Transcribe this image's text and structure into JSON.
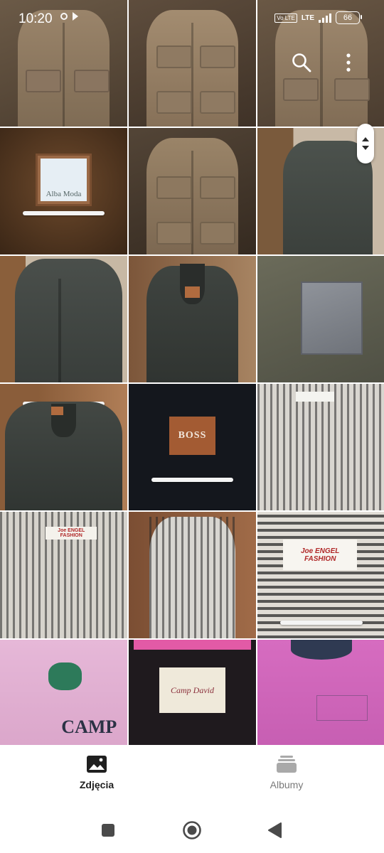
{
  "status_bar": {
    "time": "10:20",
    "network": "LTE",
    "volte": "Vo LTE",
    "battery": "66"
  },
  "toolbar": {
    "search_icon": "search-icon",
    "more_icon": "more-vert-icon"
  },
  "grid": {
    "tiles": [
      {
        "kind": "leather-jacket"
      },
      {
        "kind": "leather-jacket"
      },
      {
        "kind": "leather-jacket"
      },
      {
        "kind": "jacket-label",
        "label": "Alba Moda"
      },
      {
        "kind": "leather-jacket"
      },
      {
        "kind": "grey-coat"
      },
      {
        "kind": "grey-jacket"
      },
      {
        "kind": "grey-jacket-hanger"
      },
      {
        "kind": "fabric-closeup"
      },
      {
        "kind": "grey-jacket-hanger"
      },
      {
        "kind": "jacket-label",
        "label": "BOSS"
      },
      {
        "kind": "striped-shirt"
      },
      {
        "kind": "striped-shirt",
        "label": "Joe ENGEL FASHION"
      },
      {
        "kind": "striped-shirt"
      },
      {
        "kind": "striped-shirt-label",
        "label": "Joe ENGEL FASHION"
      },
      {
        "kind": "pink-shirt",
        "label": "CAMP"
      },
      {
        "kind": "shirt-label",
        "label": "Camp David"
      },
      {
        "kind": "pink-shirt"
      }
    ]
  },
  "bottom_nav": {
    "photos_label": "Zdjęcia",
    "albums_label": "Albumy"
  }
}
